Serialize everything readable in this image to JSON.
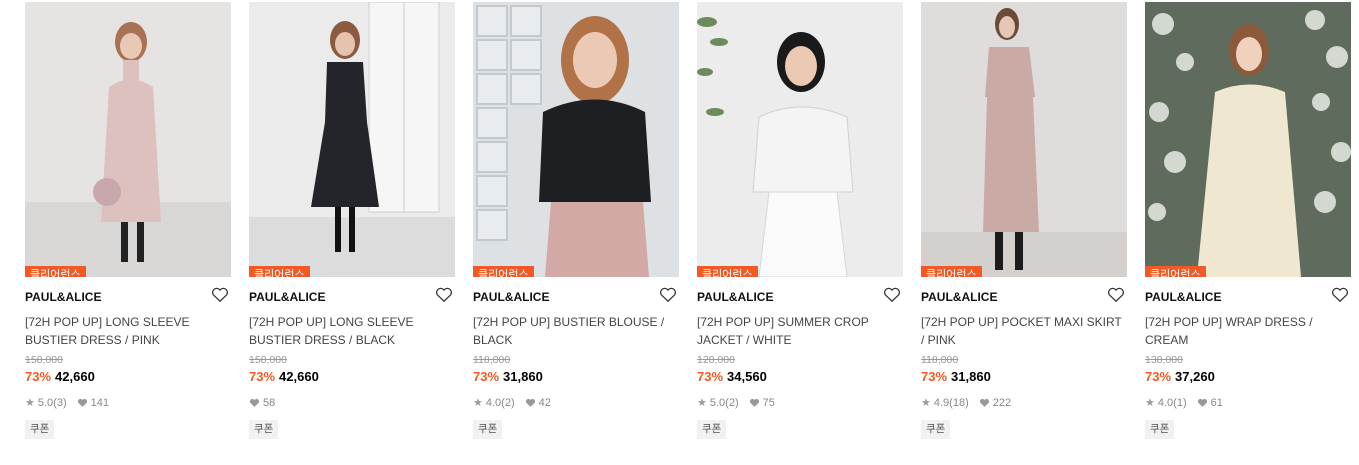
{
  "products": [
    {
      "badge": "클리어런스",
      "brand": "PAUL&ALICE",
      "name": "[72H POP UP] LONG SLEEVE BUSTIER DRESS / PINK",
      "original_price": "158,000",
      "discount": "73%",
      "price": "42,660",
      "rating": "5.0",
      "reviews": "(3)",
      "likes": "141",
      "coupon": "쿠폰",
      "bg": "#e6e4e3",
      "outfit": "#dcc1be",
      "scene": "wall"
    },
    {
      "badge": "클리어런스",
      "brand": "PAUL&ALICE",
      "name": "[72H POP UP] LONG SLEEVE BUSTIER DRESS / BLACK",
      "original_price": "158,000",
      "discount": "73%",
      "price": "42,660",
      "rating": "",
      "reviews": "",
      "likes": "58",
      "coupon": "쿠폰",
      "bg": "#e8e8e8",
      "outfit": "#24252a",
      "scene": "window"
    },
    {
      "badge": "클리어런스",
      "brand": "PAUL&ALICE",
      "name": "[72H POP UP] BUSTIER BLOUSE / BLACK",
      "original_price": "118,000",
      "discount": "73%",
      "price": "31,860",
      "rating": "4.0",
      "reviews": "(2)",
      "likes": "42",
      "coupon": "쿠폰",
      "bg": "#d9dde0",
      "outfit": "#1d1f22",
      "scene": "glass"
    },
    {
      "badge": "클리어런스",
      "brand": "PAUL&ALICE",
      "name": "[72H POP UP] SUMMER CROP JACKET / WHITE",
      "original_price": "128,000",
      "discount": "73%",
      "price": "34,560",
      "rating": "5.0",
      "reviews": "(2)",
      "likes": "75",
      "coupon": "쿠폰",
      "bg": "#ececec",
      "outfit": "#f4f4f4",
      "scene": "plant"
    },
    {
      "badge": "클리어런스",
      "brand": "PAUL&ALICE",
      "name": "[72H POP UP] POCKET MAXI SKIRT / PINK",
      "original_price": "118,000",
      "discount": "73%",
      "price": "31,860",
      "rating": "4.9",
      "reviews": "(18)",
      "likes": "222",
      "coupon": "쿠폰",
      "bg": "#dfdddc",
      "outfit": "#c9aaa5",
      "scene": "wall"
    },
    {
      "badge": "클리어런스",
      "brand": "PAUL&ALICE",
      "name": "[72H POP UP] WRAP DRESS / CREAM",
      "original_price": "138,000",
      "discount": "73%",
      "price": "37,260",
      "rating": "4.0",
      "reviews": "(1)",
      "likes": "61",
      "coupon": "쿠폰",
      "bg": "#6f7a6a",
      "outfit": "#efe7cf",
      "scene": "flowers"
    }
  ],
  "icons": {
    "wishlist": "heart-outline-icon",
    "rating": "star-icon",
    "likes": "heart-filled-icon"
  },
  "colors": {
    "accent": "#f15a24"
  }
}
